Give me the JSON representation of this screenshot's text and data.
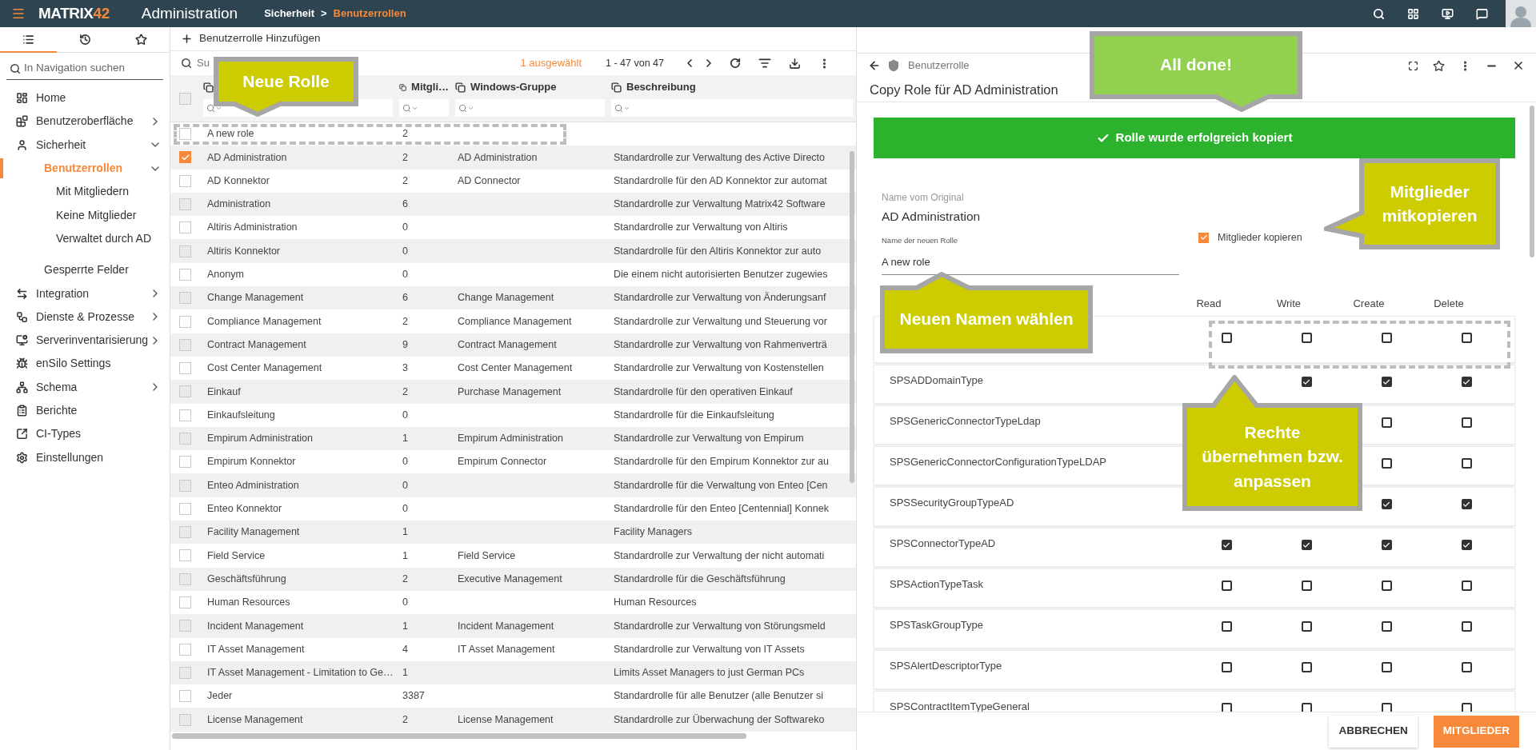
{
  "top_bar": {
    "logo": {
      "text": "MATRIX",
      "accent": "42"
    },
    "app_title": "Administration",
    "breadcrumb": [
      {
        "label": "Sicherheit",
        "current": false
      },
      {
        "label": "Benutzerrollen",
        "current": true
      }
    ],
    "separator": ">"
  },
  "nav_tabs": [
    {
      "kind": "list",
      "selected": true
    },
    {
      "kind": "history",
      "selected": false
    },
    {
      "kind": "favorites",
      "selected": false
    }
  ],
  "nav_search": {
    "placeholder": "In Navigation suchen"
  },
  "nav_items": [
    {
      "label": "Home",
      "selected": false
    },
    {
      "label": "Benutzeroberfläche",
      "selected": false,
      "expanded": false
    },
    {
      "label": "Sicherheit",
      "selected": false,
      "expanded": true,
      "children": [
        {
          "label": "Benutzerrollen",
          "selected": true,
          "expanded": true,
          "children": [
            {
              "label": "Mit Mitgliedern",
              "selected": false
            },
            {
              "label": "Keine Mitglieder",
              "selected": false
            },
            {
              "label": "Verwaltet durch AD",
              "selected": false
            }
          ]
        },
        {
          "label": "Gesperrte Felder",
          "selected": false
        }
      ]
    },
    {
      "label": "Integration",
      "selected": false,
      "expanded": false
    },
    {
      "label": "Dienste & Prozesse",
      "selected": false,
      "expanded": false
    },
    {
      "label": "Serverinventarisierung",
      "selected": false,
      "expanded": false
    },
    {
      "label": "enSilo Settings",
      "selected": false
    },
    {
      "label": "Schema",
      "selected": false,
      "expanded": false
    },
    {
      "label": "Berichte",
      "selected": false
    },
    {
      "label": "CI-Types",
      "selected": false
    },
    {
      "label": "Einstellungen",
      "selected": false
    }
  ],
  "toolbar": {
    "add_button": "Benutzerrolle Hinzufügen"
  },
  "list_search": {
    "placeholder": "Su"
  },
  "selection_count": "1 ausgewählt",
  "pagination": "1 - 47 von 47",
  "table": {
    "select_all": {
      "checked": false
    },
    "columns": [
      "Mitgli…",
      "Windows-Gruppe",
      "Beschreibung"
    ],
    "rows": [
      {
        "name": "A new role",
        "members": "2",
        "selected": false
      },
      {
        "name": "AD Administration",
        "members": "2",
        "group": "AD Administration",
        "description": "Standardrolle zur Verwaltung des Active Directo",
        "selected": true
      },
      {
        "name": "AD Konnektor",
        "members": "2",
        "group": "AD Connector",
        "description": "Standardrolle für den AD Konnektor zur automat",
        "selected": false
      },
      {
        "name": "Administration",
        "members": "6",
        "description": "Standardrolle zur Verwaltung Matrix42 Software",
        "selected": false
      },
      {
        "name": "Altiris Administration",
        "members": "0",
        "description": "Standardrolle zur Verwaltung von Altiris",
        "selected": false
      },
      {
        "name": "Altiris Konnektor",
        "members": "0",
        "description": "Standardrolle für den Altiris Konnektor zur auto",
        "selected": false
      },
      {
        "name": "Anonym",
        "members": "0",
        "description": "Die einem nicht autorisierten Benutzer zugewies",
        "selected": false
      },
      {
        "name": "Change Management",
        "members": "6",
        "group": "Change Management",
        "description": "Standardrolle zur Verwaltung von Änderungsanf",
        "selected": false
      },
      {
        "name": "Compliance Management",
        "members": "2",
        "group": "Compliance Management",
        "description": "Standardrolle zur Verwaltung und Steuerung vor",
        "selected": false
      },
      {
        "name": "Contract Management",
        "members": "9",
        "group": "Contract Management",
        "description": "Standardrolle zur Verwaltung von Rahmenverträ",
        "selected": false
      },
      {
        "name": "Cost Center Management",
        "members": "3",
        "group": "Cost Center Management",
        "description": "Standardrolle zur Verwaltung von Kostenstellen",
        "selected": false
      },
      {
        "name": "Einkauf",
        "members": "2",
        "group": "Purchase Management",
        "description": "Standardrolle für den operativen Einkauf",
        "selected": false
      },
      {
        "name": "Einkaufsleitung",
        "members": "0",
        "description": "Standardrolle für die Einkaufsleitung",
        "selected": false
      },
      {
        "name": "Empirum Administration",
        "members": "1",
        "group": "Empirum Administration",
        "description": "Standardrolle zur Verwaltung von Empirum",
        "selected": false
      },
      {
        "name": "Empirum Konnektor",
        "members": "0",
        "group": "Empirum Connector",
        "description": "Standardrolle für den Empirum Konnektor zur au",
        "selected": false
      },
      {
        "name": "Enteo Administration",
        "members": "0",
        "description": "Standardrolle für die Verwaltung von Enteo [Cen",
        "selected": false
      },
      {
        "name": "Enteo Konnektor",
        "members": "0",
        "description": "Standardrolle für den Enteo [Centennial] Konnek",
        "selected": false
      },
      {
        "name": "Facility Management",
        "members": "1",
        "description": "Facility Managers",
        "selected": false
      },
      {
        "name": "Field Service",
        "members": "1",
        "group": "Field Service",
        "description": "Standardrolle zur Verwaltung der nicht automati",
        "selected": false
      },
      {
        "name": "Geschäftsführung",
        "members": "2",
        "group": "Executive Management",
        "description": "Standardrolle für die Geschäftsführung",
        "selected": false
      },
      {
        "name": "Human Resources",
        "members": "0",
        "description": "Human Resources",
        "selected": false
      },
      {
        "name": "Incident Management",
        "members": "1",
        "group": "Incident Management",
        "description": "Standardrolle zur Verwaltung von Störungsmeld",
        "selected": false
      },
      {
        "name": "IT Asset Management",
        "members": "4",
        "group": "IT Asset Management",
        "description": "Standardrolle zur Verwaltung von IT Assets",
        "selected": false
      },
      {
        "name": "IT Asset Management - Limitation to Ge…",
        "members": "1",
        "description": "Limits Asset Managers to just German PCs",
        "selected": false
      },
      {
        "name": "Jeder",
        "members": "3387",
        "description": "Standardrolle für alle Benutzer (alle Benutzer si",
        "selected": false
      },
      {
        "name": "License Management",
        "members": "2",
        "group": "License Management",
        "description": "Standardrolle zur Überwachung der Softwareko",
        "selected": false
      }
    ]
  },
  "detail": {
    "header_label": "Benutzerrolle",
    "title": "Copy Role für AD Administration",
    "banner": "Rolle wurde erfolgreich kopiert",
    "original_label": "Name vom Original",
    "original_value": "AD Administration",
    "new_name": {
      "label": "Name der neuen Rolle",
      "value": "A new role"
    },
    "copy_members": {
      "label": "Mitglieder kopieren",
      "checked": true
    },
    "rights_columns": [
      "Read",
      "Write",
      "Create",
      "Delete"
    ],
    "rights_rows": [
      {
        "read": false,
        "write": false,
        "create": false,
        "delete": false
      },
      {
        "name": "SPSADDomainType",
        "write": true,
        "create": true,
        "delete": true
      },
      {
        "name": "SPSGenericConnectorTypeLdap",
        "create": false,
        "delete": false
      },
      {
        "name": "SPSGenericConnectorConfigurationTypeLDAP",
        "create": false,
        "delete": false
      },
      {
        "name": "SPSSecurityGroupTypeAD",
        "create": true,
        "delete": true
      },
      {
        "name": "SPSConnectorTypeAD",
        "read": true,
        "write": true,
        "create": true,
        "delete": true
      },
      {
        "name": "SPSActionTypeTask",
        "read": false,
        "write": false,
        "create": false,
        "delete": false
      },
      {
        "name": "SPSTaskGroupType",
        "read": false,
        "write": false,
        "create": false,
        "delete": false
      },
      {
        "name": "SPSAlertDescriptorType",
        "read": false,
        "write": false,
        "create": false,
        "delete": false
      },
      {
        "name": "SPSContractItemTypeGeneral",
        "read": false,
        "write": false,
        "create": false,
        "delete": false
      }
    ],
    "buttons": [
      {
        "label": "ABBRECHEN",
        "kind": "secondary"
      },
      {
        "label": "MITGLIEDER",
        "kind": "primary"
      }
    ]
  },
  "annotations": [
    {
      "text": "Neue Rolle",
      "color": "#cccc00"
    },
    {
      "text": "All done!",
      "color": "#92d050"
    },
    {
      "text": "Mitglieder mitkopieren",
      "color": "#cccc00"
    },
    {
      "text": "Neuen Namen wählen",
      "color": "#cccc00"
    },
    {
      "text": "Rechte übernehmen bzw. anpassen",
      "color": "#cccc00"
    }
  ]
}
